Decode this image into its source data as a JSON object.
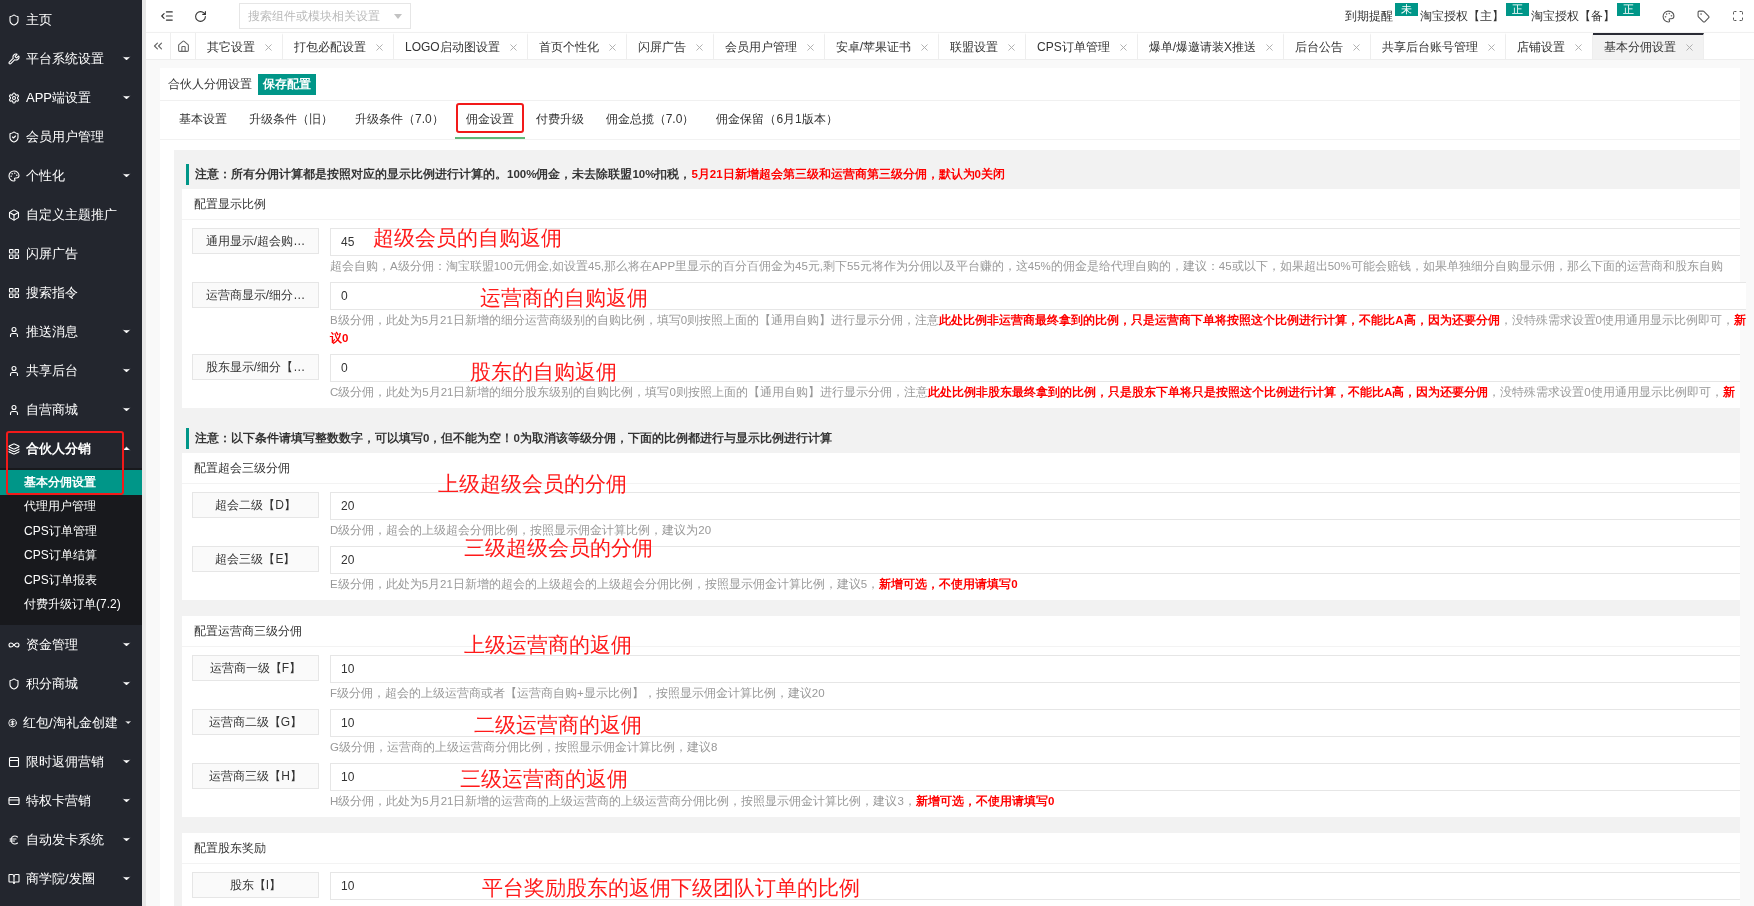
{
  "sidebar": {
    "items": [
      {
        "label": "主页",
        "kind": "link",
        "expanded": false,
        "highlighted": false
      },
      {
        "label": "平台系统设置",
        "kind": "menu",
        "expanded": false,
        "highlighted": false
      },
      {
        "label": "APP端设置",
        "kind": "menu",
        "expanded": false,
        "highlighted": false
      },
      {
        "label": "会员用户管理",
        "kind": "link",
        "expanded": false,
        "highlighted": false
      },
      {
        "label": "个性化",
        "kind": "menu",
        "expanded": false,
        "highlighted": false
      },
      {
        "label": "自定义主题推广",
        "kind": "link",
        "expanded": false,
        "highlighted": false
      },
      {
        "label": "闪屏广告",
        "kind": "link",
        "expanded": false,
        "highlighted": false
      },
      {
        "label": "搜索指令",
        "kind": "link",
        "expanded": false,
        "highlighted": false
      },
      {
        "label": "推送消息",
        "kind": "menu",
        "expanded": false,
        "highlighted": false
      },
      {
        "label": "共享后台",
        "kind": "menu",
        "expanded": false,
        "highlighted": false
      },
      {
        "label": "自营商城",
        "kind": "menu",
        "expanded": false,
        "highlighted": false
      },
      {
        "label": "合伙人分销",
        "kind": "menu",
        "expanded": true,
        "highlighted": true,
        "children": [
          {
            "label": "基本分佣设置",
            "selected": true
          },
          {
            "label": "代理用户管理",
            "selected": false
          },
          {
            "label": "CPS订单管理",
            "selected": false
          },
          {
            "label": "CPS订单结算",
            "selected": false
          },
          {
            "label": "CPS订单报表",
            "selected": false
          },
          {
            "label": "付费升级订单(7.2)",
            "selected": false
          }
        ]
      },
      {
        "label": "资金管理",
        "kind": "menu",
        "expanded": false,
        "highlighted": false
      },
      {
        "label": "积分商城",
        "kind": "menu",
        "expanded": false,
        "highlighted": false
      },
      {
        "label": "红包/淘礼金创建",
        "kind": "menu",
        "expanded": false,
        "highlighted": false
      },
      {
        "label": "限时返佣营销",
        "kind": "menu",
        "expanded": false,
        "highlighted": false
      },
      {
        "label": "特权卡营销",
        "kind": "menu",
        "expanded": false,
        "highlighted": false
      },
      {
        "label": "自动发卡系统",
        "kind": "menu",
        "expanded": false,
        "highlighted": false
      },
      {
        "label": "商学院/发圈",
        "kind": "menu",
        "expanded": false,
        "highlighted": false
      }
    ]
  },
  "header": {
    "search": {
      "placeholder": "搜索组件或模块相关设置"
    },
    "status": [
      {
        "label": "到期提醒",
        "badge": "未"
      },
      {
        "label": "淘宝授权【主】",
        "badge": "正"
      },
      {
        "label": "淘宝授权【备】",
        "badge": "正"
      }
    ]
  },
  "tabs": [
    {
      "label": "其它设置",
      "selected": false
    },
    {
      "label": "打包必配设置",
      "selected": false
    },
    {
      "label": "LOGO启动图设置",
      "selected": false
    },
    {
      "label": "首页个性化",
      "selected": false
    },
    {
      "label": "闪屏广告",
      "selected": false
    },
    {
      "label": "会员用户管理",
      "selected": false
    },
    {
      "label": "安卓/苹果证书",
      "selected": false
    },
    {
      "label": "联盟设置",
      "selected": false
    },
    {
      "label": "CPS订单管理",
      "selected": false
    },
    {
      "label": "爆单/爆邀请装X推送",
      "selected": false
    },
    {
      "label": "后台公告",
      "selected": false
    },
    {
      "label": "共享后台账号管理",
      "selected": false
    },
    {
      "label": "店铺设置",
      "selected": false
    },
    {
      "label": "基本分佣设置",
      "selected": true
    }
  ],
  "page": {
    "title": "合伙人分佣设置",
    "save_button": "保存配置",
    "subtabs": [
      {
        "label": "基本设置",
        "selected": false,
        "highlighted": false
      },
      {
        "label": "升级条件（旧）",
        "selected": false,
        "highlighted": false
      },
      {
        "label": "升级条件（7.0）",
        "selected": false,
        "highlighted": false
      },
      {
        "label": "佣金设置",
        "selected": true,
        "highlighted": true
      },
      {
        "label": "付费升级",
        "selected": false,
        "highlighted": false
      },
      {
        "label": "佣金总揽（7.0）",
        "selected": false,
        "highlighted": false
      },
      {
        "label": "佣金保留（6月1版本）",
        "selected": false,
        "highlighted": false
      }
    ],
    "sections": [
      {
        "kind": "notice",
        "parts": [
          {
            "text": "注意：所有分佣计算都是按照对应的显示比例进行计算的。100%佣金，未去除联盟10%扣税，",
            "emphasis": false
          },
          {
            "text": "5月21日新增超会第三级和运营商第三级分佣，默认为0关闭",
            "emphasis": true
          }
        ]
      },
      {
        "kind": "panel",
        "title": "配置显示比例",
        "fields": [
          {
            "label": "通用显示/超会购…",
            "value": "45",
            "annotation": "超级会员的自购返佣",
            "hint": [
              [
                {
                  "text": "超会自购，A级分佣：淘宝联盟100元佣金,如设置45,那么将在APP里显示的百分百佣金为45元,剩下55元将作为分佣以及平台赚的，这45%的佣金是给代理自购的，建议：45或以下，如果超出50%可能会赔钱，如果单独细分自购显示佣，那么下面的运营商和股东自购",
                  "emphasis": false
                }
              ]
            ]
          },
          {
            "label": "运营商显示/细分…",
            "value": "0",
            "annotation": "运营商的自购返佣",
            "hint": [
              [
                {
                  "text": "B级分佣，此处为5月21日新增的细分运营商级别的自购比例，填写0则按照上面的【通用自购】进行显示分佣，注意",
                  "emphasis": false
                },
                {
                  "text": "此处比例非运营商最终拿到的比例，只是运营商下单将按照这个比例进行计算，不能比A高，因为还要分佣",
                  "emphasis": true
                },
                {
                  "text": "，没特殊需求设置0使用通用显示比例即可，",
                  "emphasis": false
                },
                {
                  "text": "新",
                  "emphasis": true
                }
              ],
              [
                {
                  "text": "议0",
                  "emphasis": true
                }
              ]
            ]
          },
          {
            "label": "股东显示/细分【…",
            "value": "0",
            "annotation": "股东的自购返佣",
            "hint": [
              [
                {
                  "text": "C级分佣，此处为5月21日新增的细分股东级别的自购比例，填写0则按照上面的【通用自购】进行显示分佣，注意",
                  "emphasis": false
                },
                {
                  "text": "此处比例非股东最终拿到的比例，只是股东下单将只是按照这个比例进行计算，不能比A高，因为还要分佣",
                  "emphasis": true
                },
                {
                  "text": "，没特殊需求设置0使用通用显示比例即可，",
                  "emphasis": false
                },
                {
                  "text": "新",
                  "emphasis": true
                }
              ]
            ]
          }
        ]
      },
      {
        "kind": "notice",
        "parts": [
          {
            "text": "注意：以下条件请填写整数数字，可以填写0，但不能为空！0为取消该等级分佣，下面的比例都进行与显示比例进行计算",
            "emphasis": false
          }
        ]
      },
      {
        "kind": "panel",
        "title": "配置超会三级分佣",
        "fields": [
          {
            "label": "超会二级【D】",
            "value": "20",
            "annotation": "上级超级会员的分佣",
            "hint": [
              [
                {
                  "text": "D级分佣，超会的上级超会分佣比例，按照显示佣金计算比例，建议为20",
                  "emphasis": false
                }
              ]
            ]
          },
          {
            "label": "超会三级【E】",
            "value": "20",
            "annotation": "三级超级会员的分佣",
            "hint": [
              [
                {
                  "text": "E级分佣，此处为5月21日新增的超会的上级超会的上级超会分佣比例，按照显示佣金计算比例，建议5，",
                  "emphasis": false
                },
                {
                  "text": "新增可选，不使用请填写0",
                  "emphasis": true
                }
              ]
            ]
          }
        ]
      },
      {
        "kind": "panel",
        "title": "配置运营商三级分佣",
        "fields": [
          {
            "label": "运营商一级【F】",
            "value": "10",
            "annotation": "上级运营商的返佣",
            "hint": [
              [
                {
                  "text": "F级分佣，超会的上级运营商或者【运营商自购+显示比例】，按照显示佣金计算比例，建议20",
                  "emphasis": false
                }
              ]
            ]
          },
          {
            "label": "运营商二级【G】",
            "value": "10",
            "annotation": "二级运营商的返佣",
            "hint": [
              [
                {
                  "text": "G级分佣，运营商的上级运营商分佣比例，按照显示佣金计算比例，建议8",
                  "emphasis": false
                }
              ]
            ]
          },
          {
            "label": "运营商三级【H】",
            "value": "10",
            "annotation": "三级运营商的返佣",
            "hint": [
              [
                {
                  "text": "H级分佣，此处为5月21日新增的运营商的上级运营商的上级运营商分佣比例，按照显示佣金计算比例，建议3，",
                  "emphasis": false
                },
                {
                  "text": "新增可选，不使用请填写0",
                  "emphasis": true
                }
              ]
            ]
          }
        ]
      },
      {
        "kind": "panel",
        "title": "配置股东奖励",
        "fields": [
          {
            "label": "股东【I】",
            "value": "10",
            "annotation": "平台奖励股东的返佣下级团队订单的比例"
          }
        ]
      }
    ]
  }
}
